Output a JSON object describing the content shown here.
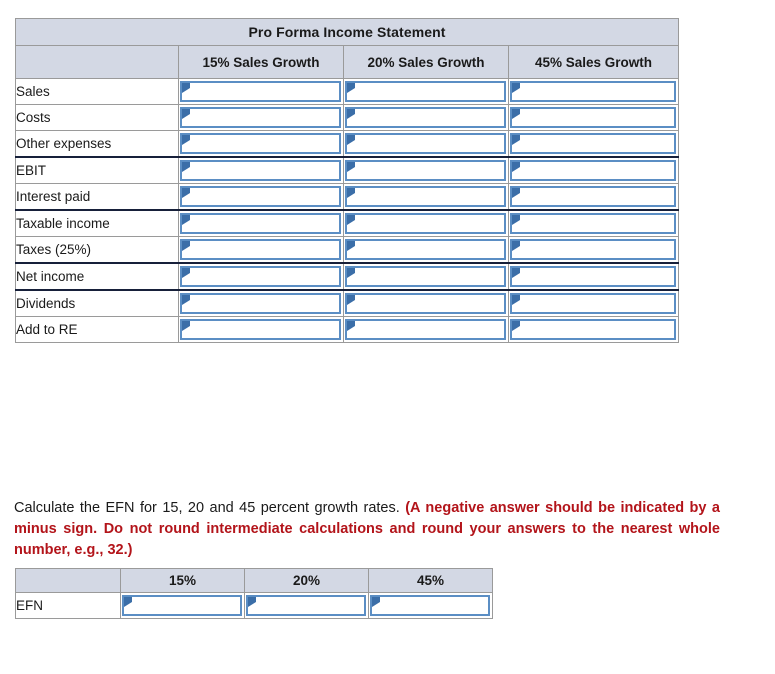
{
  "proforma": {
    "title": "Pro Forma Income Statement",
    "corner_label": "",
    "columns": [
      "15% Sales Growth",
      "20% Sales Growth",
      "45% Sales Growth"
    ],
    "rows": [
      {
        "label": "Sales",
        "separator_above": false
      },
      {
        "label": "Costs",
        "separator_above": false
      },
      {
        "label": "Other expenses",
        "separator_above": false
      },
      {
        "label": "EBIT",
        "separator_above": true
      },
      {
        "label": "Interest paid",
        "separator_above": false
      },
      {
        "label": "Taxable income",
        "separator_above": true
      },
      {
        "label": "Taxes (25%)",
        "separator_above": false
      },
      {
        "label": "Net income",
        "separator_above": true
      },
      {
        "label": "Dividends",
        "separator_above": true
      },
      {
        "label": "Add to RE",
        "separator_above": false
      }
    ],
    "cell_value": "",
    "cell_placeholder": ""
  },
  "instructions": {
    "plain": "Calculate the EFN for 15, 20 and 45 percent growth rates. ",
    "emphasis": "(A negative answer should be indicated by a minus sign. Do not round intermediate calculations and round your answers to the nearest whole number, e.g., 32.)"
  },
  "efn": {
    "corner_label": "",
    "columns": [
      "15%",
      "20%",
      "45%"
    ],
    "rows": [
      {
        "label": "EFN"
      }
    ],
    "cell_value": "",
    "cell_placeholder": ""
  },
  "colors": {
    "header_fill": "#d3d8e4",
    "grid_line": "#9a9a9a",
    "input_border": "#5b8ec4",
    "marker": "#3b6ea8",
    "emphasis_text": "#b3141a",
    "body_text": "#1a1a1a"
  }
}
